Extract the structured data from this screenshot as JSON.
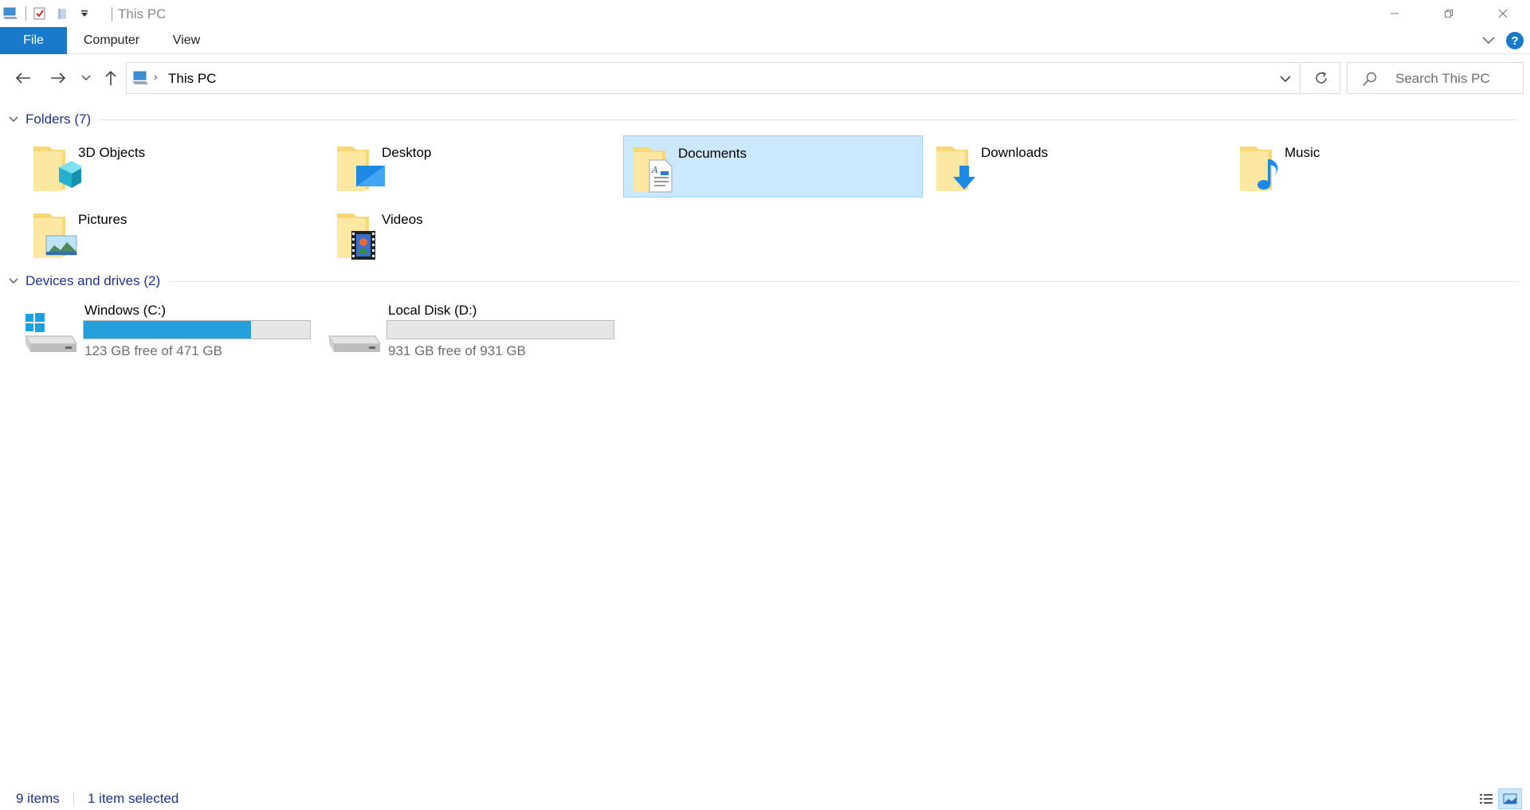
{
  "window": {
    "title": "This PC",
    "controls": {
      "minimize": "—",
      "maximize": "❐",
      "close": "✕"
    }
  },
  "ribbon": {
    "tabs": [
      {
        "label": "File"
      },
      {
        "label": "Computer"
      },
      {
        "label": "View"
      }
    ],
    "help_label": "?"
  },
  "navigation": {
    "breadcrumb": [
      "This PC"
    ],
    "search_placeholder": "Search This PC"
  },
  "groups": {
    "folders": {
      "title": "Folders (7)",
      "items": [
        {
          "name": "3D Objects",
          "icon": "3d-objects-folder-icon",
          "selected": false
        },
        {
          "name": "Desktop",
          "icon": "desktop-folder-icon",
          "selected": false
        },
        {
          "name": "Documents",
          "icon": "documents-folder-icon",
          "selected": true
        },
        {
          "name": "Downloads",
          "icon": "downloads-folder-icon",
          "selected": false
        },
        {
          "name": "Music",
          "icon": "music-folder-icon",
          "selected": false
        },
        {
          "name": "Pictures",
          "icon": "pictures-folder-icon",
          "selected": false
        },
        {
          "name": "Videos",
          "icon": "videos-folder-icon",
          "selected": false
        }
      ]
    },
    "drives": {
      "title": "Devices and drives (2)",
      "items": [
        {
          "name": "Windows (C:)",
          "free_text": "123 GB free of 471 GB",
          "used_fraction": 0.739,
          "icon": "windows-drive-icon"
        },
        {
          "name": "Local Disk (D:)",
          "free_text": "931 GB free of 931 GB",
          "used_fraction": 0.0,
          "icon": "local-disk-icon"
        }
      ]
    }
  },
  "status": {
    "item_count": "9 items",
    "selection": "1 item selected"
  },
  "colors": {
    "accent": "#1979ca",
    "selection_bg": "#cce8ff",
    "selection_border": "#99d1ff",
    "drive_fill": "#26a0da",
    "group_title": "#1e3287",
    "folder_yellow": "#f8d775"
  }
}
